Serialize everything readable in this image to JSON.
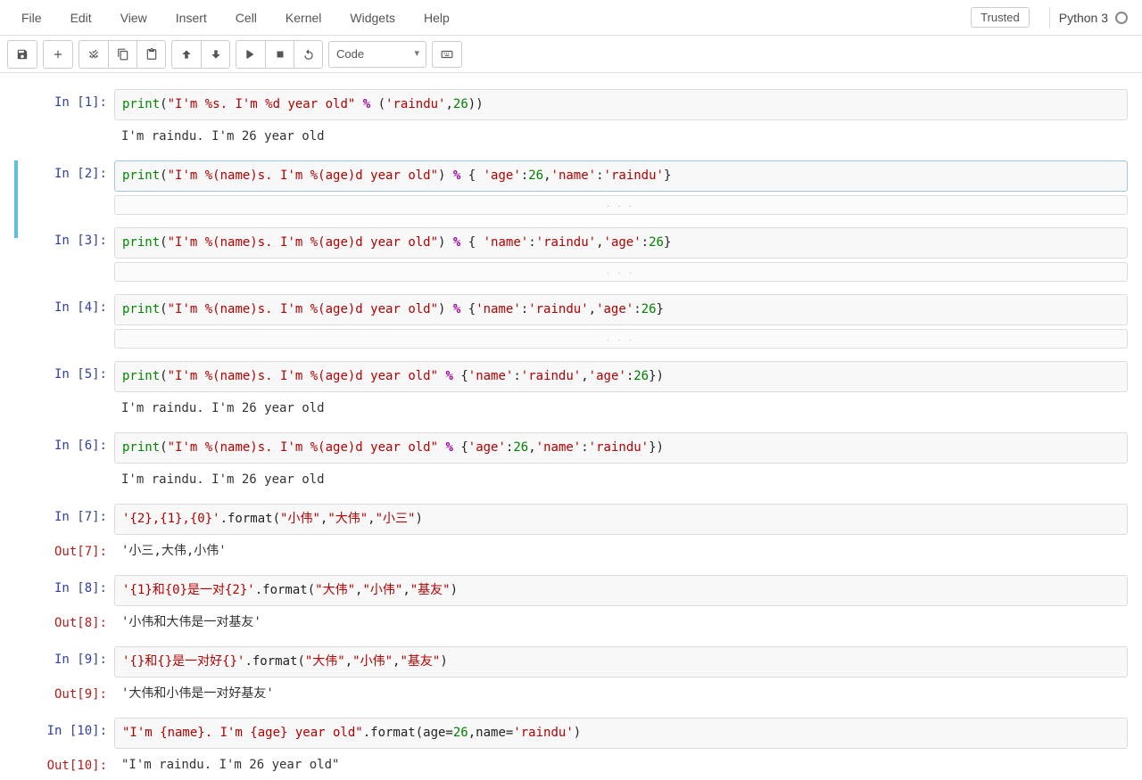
{
  "menu": {
    "file": "File",
    "edit": "Edit",
    "view": "View",
    "insert": "Insert",
    "cell": "Cell",
    "kernel": "Kernel",
    "widgets": "Widgets",
    "help": "Help"
  },
  "header": {
    "trusted": "Trusted",
    "kernel_name": "Python 3"
  },
  "toolbar": {
    "celltype": "Code"
  },
  "collapse_marker": ". . .",
  "cells": [
    {
      "n": "1",
      "in_prompt": "In  [1]:",
      "out_prompt": "",
      "output": "I'm raindu. I'm 26 year old",
      "out_collapsed": false,
      "tokens": [
        {
          "t": "print",
          "c": "kw"
        },
        {
          "t": "(",
          "c": "pn"
        },
        {
          "t": "\"I'm %s. I'm %d year old\"",
          "c": "str"
        },
        {
          "t": " ",
          "c": "pn"
        },
        {
          "t": "%",
          "c": "op"
        },
        {
          "t": " (",
          "c": "pn"
        },
        {
          "t": "'raindu'",
          "c": "str"
        },
        {
          "t": ",",
          "c": "pn"
        },
        {
          "t": "26",
          "c": "num"
        },
        {
          "t": "))",
          "c": "pn"
        }
      ]
    },
    {
      "n": "2",
      "in_prompt": "In  [2]:",
      "selected": true,
      "out_collapsed": true,
      "tokens": [
        {
          "t": "print",
          "c": "kw"
        },
        {
          "t": "(",
          "c": "pn"
        },
        {
          "t": "\"I'm %(name)s. I'm %(age)d year old\"",
          "c": "str"
        },
        {
          "t": ") ",
          "c": "pn"
        },
        {
          "t": "%",
          "c": "op"
        },
        {
          "t": " { ",
          "c": "pn"
        },
        {
          "t": "'age'",
          "c": "str"
        },
        {
          "t": ":",
          "c": "pn"
        },
        {
          "t": "26",
          "c": "num"
        },
        {
          "t": ",",
          "c": "pn"
        },
        {
          "t": "'name'",
          "c": "str"
        },
        {
          "t": ":",
          "c": "pn"
        },
        {
          "t": "'raindu'",
          "c": "str"
        },
        {
          "t": "}",
          "c": "pn"
        }
      ]
    },
    {
      "n": "3",
      "in_prompt": "In  [3]:",
      "out_collapsed": true,
      "tokens": [
        {
          "t": "print",
          "c": "kw"
        },
        {
          "t": "(",
          "c": "pn"
        },
        {
          "t": "\"I'm %(name)s. I'm %(age)d year old\"",
          "c": "str"
        },
        {
          "t": ") ",
          "c": "pn"
        },
        {
          "t": "%",
          "c": "op"
        },
        {
          "t": " { ",
          "c": "pn"
        },
        {
          "t": "'name'",
          "c": "str"
        },
        {
          "t": ":",
          "c": "pn"
        },
        {
          "t": "'raindu'",
          "c": "str"
        },
        {
          "t": ",",
          "c": "pn"
        },
        {
          "t": "'age'",
          "c": "str"
        },
        {
          "t": ":",
          "c": "pn"
        },
        {
          "t": "26",
          "c": "num"
        },
        {
          "t": "}",
          "c": "pn"
        }
      ]
    },
    {
      "n": "4",
      "in_prompt": "In  [4]:",
      "out_collapsed": true,
      "tokens": [
        {
          "t": "print",
          "c": "kw"
        },
        {
          "t": "(",
          "c": "pn"
        },
        {
          "t": "\"I'm %(name)s. I'm %(age)d year old\"",
          "c": "str"
        },
        {
          "t": ") ",
          "c": "pn"
        },
        {
          "t": "%",
          "c": "op"
        },
        {
          "t": " {",
          "c": "pn"
        },
        {
          "t": "'name'",
          "c": "str"
        },
        {
          "t": ":",
          "c": "pn"
        },
        {
          "t": "'raindu'",
          "c": "str"
        },
        {
          "t": ",",
          "c": "pn"
        },
        {
          "t": "'age'",
          "c": "str"
        },
        {
          "t": ":",
          "c": "pn"
        },
        {
          "t": "26",
          "c": "num"
        },
        {
          "t": "}",
          "c": "pn"
        }
      ]
    },
    {
      "n": "5",
      "in_prompt": "In  [5]:",
      "output": "I'm raindu. I'm 26 year old",
      "tokens": [
        {
          "t": "print",
          "c": "kw"
        },
        {
          "t": "(",
          "c": "pn"
        },
        {
          "t": "\"I'm %(name)s. I'm %(age)d year old\"",
          "c": "str"
        },
        {
          "t": " ",
          "c": "pn"
        },
        {
          "t": "%",
          "c": "op"
        },
        {
          "t": " {",
          "c": "pn"
        },
        {
          "t": "'name'",
          "c": "str"
        },
        {
          "t": ":",
          "c": "pn"
        },
        {
          "t": "'raindu'",
          "c": "str"
        },
        {
          "t": ",",
          "c": "pn"
        },
        {
          "t": "'age'",
          "c": "str"
        },
        {
          "t": ":",
          "c": "pn"
        },
        {
          "t": "26",
          "c": "num"
        },
        {
          "t": "})",
          "c": "pn"
        }
      ]
    },
    {
      "n": "6",
      "in_prompt": "In  [6]:",
      "output": "I'm raindu. I'm 26 year old",
      "tokens": [
        {
          "t": "print",
          "c": "kw"
        },
        {
          "t": "(",
          "c": "pn"
        },
        {
          "t": "\"I'm %(name)s. I'm %(age)d year old\"",
          "c": "str"
        },
        {
          "t": " ",
          "c": "pn"
        },
        {
          "t": "%",
          "c": "op"
        },
        {
          "t": " {",
          "c": "pn"
        },
        {
          "t": "'age'",
          "c": "str"
        },
        {
          "t": ":",
          "c": "pn"
        },
        {
          "t": "26",
          "c": "num"
        },
        {
          "t": ",",
          "c": "pn"
        },
        {
          "t": "'name'",
          "c": "str"
        },
        {
          "t": ":",
          "c": "pn"
        },
        {
          "t": "'raindu'",
          "c": "str"
        },
        {
          "t": "})",
          "c": "pn"
        }
      ]
    },
    {
      "n": "7",
      "in_prompt": "In  [7]:",
      "out_prompt": "Out[7]:",
      "output": "'小三,大伟,小伟'",
      "tokens": [
        {
          "t": "'{2},{1},{0}'",
          "c": "str"
        },
        {
          "t": ".format(",
          "c": "fn"
        },
        {
          "t": "\"小伟\"",
          "c": "str"
        },
        {
          "t": ",",
          "c": "pn"
        },
        {
          "t": "\"大伟\"",
          "c": "str"
        },
        {
          "t": ",",
          "c": "pn"
        },
        {
          "t": "\"小三\"",
          "c": "str"
        },
        {
          "t": ")",
          "c": "pn"
        }
      ]
    },
    {
      "n": "8",
      "in_prompt": "In  [8]:",
      "out_prompt": "Out[8]:",
      "output": "'小伟和大伟是一对基友'",
      "tokens": [
        {
          "t": "'{1}和{0}是一对{2}'",
          "c": "str"
        },
        {
          "t": ".format(",
          "c": "fn"
        },
        {
          "t": "\"大伟\"",
          "c": "str"
        },
        {
          "t": ",",
          "c": "pn"
        },
        {
          "t": "\"小伟\"",
          "c": "str"
        },
        {
          "t": ",",
          "c": "pn"
        },
        {
          "t": "\"基友\"",
          "c": "str"
        },
        {
          "t": ")",
          "c": "pn"
        }
      ]
    },
    {
      "n": "9",
      "in_prompt": "In  [9]:",
      "out_prompt": "Out[9]:",
      "output": "'大伟和小伟是一对好基友'",
      "tokens": [
        {
          "t": "'{}和{}是一对好{}'",
          "c": "str"
        },
        {
          "t": ".format(",
          "c": "fn"
        },
        {
          "t": "\"大伟\"",
          "c": "str"
        },
        {
          "t": ",",
          "c": "pn"
        },
        {
          "t": "\"小伟\"",
          "c": "str"
        },
        {
          "t": ",",
          "c": "pn"
        },
        {
          "t": "\"基友\"",
          "c": "str"
        },
        {
          "t": ")",
          "c": "pn"
        }
      ]
    },
    {
      "n": "10",
      "in_prompt": "In [10]:",
      "out_prompt": "Out[10]:",
      "output": "\"I'm raindu. I'm 26 year old\"",
      "tokens": [
        {
          "t": "\"I'm {name}. I'm {age} year old\"",
          "c": "str"
        },
        {
          "t": ".format(age=",
          "c": "fn"
        },
        {
          "t": "26",
          "c": "num"
        },
        {
          "t": ",name=",
          "c": "fn"
        },
        {
          "t": "'raindu'",
          "c": "str"
        },
        {
          "t": ")",
          "c": "pn"
        }
      ]
    }
  ]
}
